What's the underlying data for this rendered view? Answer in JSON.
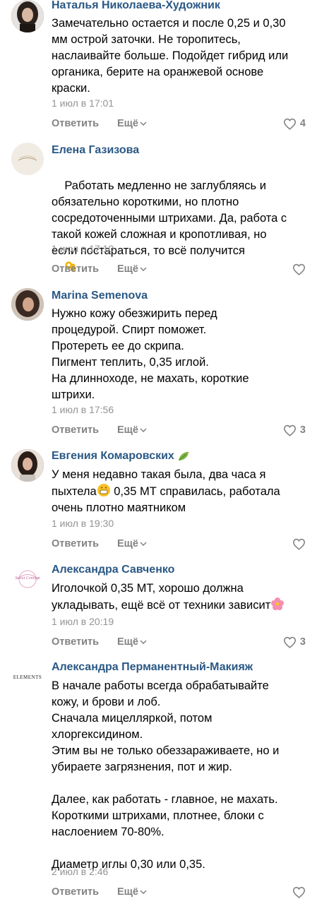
{
  "comments": [
    {
      "author": "Наталья Николаева-Художник",
      "body": "Замечательно остается и после 0,25 и 0,30\nмм острой заточки. Не торопитесь,\nнаслаивайте больше. Подойдет гибрид или\nорганика, берите на оранжевой основе\nкраски.",
      "time": "1 июл в 17:01",
      "reply": "Ответить",
      "more": "Ещё",
      "likes": "4"
    },
    {
      "author": "Елена Газизова",
      "body": "Работать медленно не заглубляясь и\nобязательно короткими, но плотно\nсосредоточенными штрихами. Да, работа с\nтакой кожей сложная и кропотливая, но\nесли постараться, то всё получится",
      "time": "1 июл в 17:10",
      "reply": "Ответить",
      "more": "Ещё",
      "likes": ""
    },
    {
      "author": "Marina Semenova",
      "body": "Нужно кожу обезжирить перед\nпроцедурой. Спирт поможет.\nПротереть ее до скрипа.\nПигмент теплить, 0,35 иглой.\nНа длинноходе, не махать, короткие\nштрихи.",
      "time": "1 июл в 17:56",
      "reply": "Ответить",
      "more": "Ещё",
      "likes": "3"
    },
    {
      "author": "Евгения Комаровских",
      "body_a": "У меня недавно такая была, два часа я\nпыхтела",
      "body_b": " 0,35 МТ справилась, работала\nочень плотно маятником",
      "time": "1 июл в 19:30",
      "reply": "Ответить",
      "more": "Ещё",
      "likes": ""
    },
    {
      "author": "Александра Савченко",
      "avatar_text": "Sweet Concept",
      "body": "Иголочкой 0,35 МТ, хорошо должна\nукладывать, ещё всё от техники зависит",
      "time": "1 июл в 20:19",
      "reply": "Ответить",
      "more": "Ещё",
      "likes": "3"
    },
    {
      "author": "Александра Перманентный-Макияж",
      "avatar_text": "ELEMENTS",
      "body": "В начале работы всегда обрабатывайте\nкожу, и брови и лоб.\nСначала мицелляркой, потом\nхлоргексидином.\nЭтим вы не только обеззараживаете, но и\nубираете загрязнения, пот и жир.\n\nДалее, как работать - главное, не махать.\nКороткими штрихами, плотнее, блоки с\nнаслоением 70-80%.\n\nДиаметр иглы 0,30 или 0,35.",
      "time": "2 июл в 2:46",
      "reply": "Ответить",
      "more": "Ещё",
      "likes": ""
    }
  ],
  "colors": {
    "author": "#2a5885",
    "meta": "#939393",
    "action": "#828282"
  },
  "icons": [
    "heart-outline-icon",
    "chevron-down-icon",
    "ok-hand-emoji",
    "grinning-emoji",
    "blossom-emoji",
    "leaf-emoji"
  ]
}
